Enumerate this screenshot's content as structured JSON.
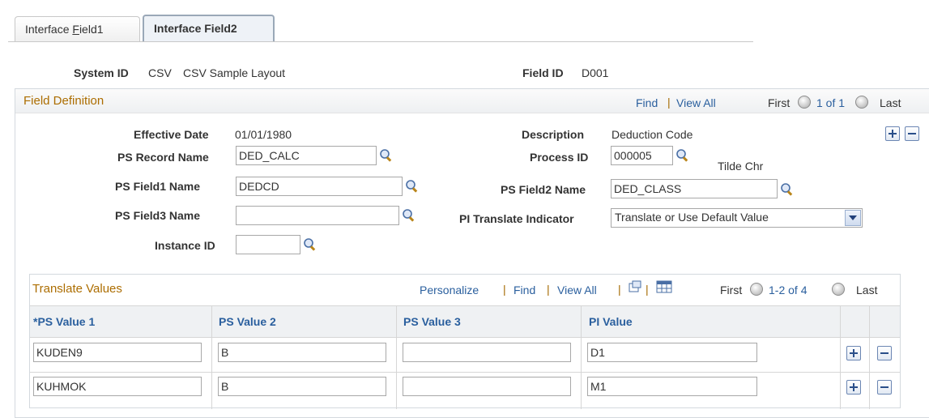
{
  "tabs": [
    {
      "label_pre": "Interface ",
      "label_acc": "F",
      "label_post": "ield1"
    },
    {
      "label": "Interface Field2"
    }
  ],
  "header": {
    "system_id_label": "System ID",
    "system_id_value": "CSV",
    "system_id_desc": "CSV Sample Layout",
    "field_id_label": "Field ID",
    "field_id_value": "D001"
  },
  "field_definition": {
    "title": "Field Definition",
    "find": "Find",
    "view_all": "View All",
    "first": "First",
    "range": "1 of 1",
    "last": "Last",
    "effective_date_label": "Effective Date",
    "effective_date_value": "01/01/1980",
    "description_label": "Description",
    "description_value": "Deduction Code",
    "ps_record_label": "PS Record Name",
    "ps_record_value": "DED_CALC",
    "process_id_label": "Process ID",
    "process_id_value": "000005",
    "process_id_desc": "Tilde Chr",
    "ps_field1_label": "PS Field1 Name",
    "ps_field1_value": "DEDCD",
    "ps_field2_label": "PS Field2 Name",
    "ps_field2_value": "DED_CLASS",
    "ps_field3_label": "PS Field3 Name",
    "ps_field3_value": "",
    "pi_translate_label": "PI Translate Indicator",
    "pi_translate_value": "Translate or Use Default Value",
    "instance_id_label": "Instance ID",
    "instance_id_value": ""
  },
  "translate_values": {
    "title": "Translate Values",
    "personalize": "Personalize",
    "find": "Find",
    "view_all": "View All",
    "first": "First",
    "range": "1-2 of 4",
    "last": "Last",
    "columns": [
      "*PS Value 1",
      "PS Value 2",
      "PS Value 3",
      "PI Value"
    ],
    "rows": [
      {
        "v1": "KUDEN9",
        "v2": "B",
        "v3": "",
        "pi": "D1"
      },
      {
        "v1": "KUHMOK",
        "v2": "B",
        "v3": "",
        "pi": "M1"
      }
    ]
  },
  "colors": {
    "link": "#2a5f9e",
    "group_title": "#ac6d00",
    "border": "#d4d9de"
  }
}
